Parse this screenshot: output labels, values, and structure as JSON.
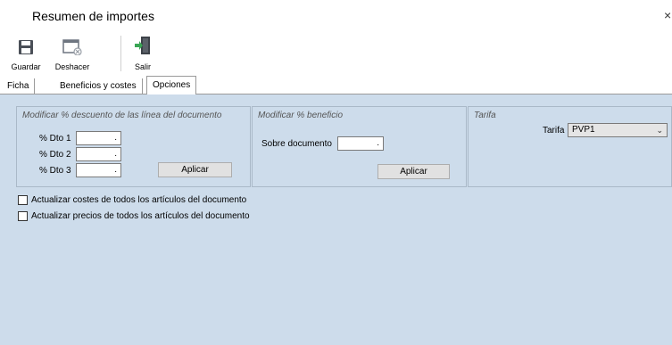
{
  "window": {
    "title": "Resumen de importes",
    "close_glyph": "×"
  },
  "toolbar": {
    "items": [
      {
        "label": "Guardar",
        "icon": "save-icon"
      },
      {
        "label": "Deshacer",
        "icon": "undo-icon"
      },
      {
        "label": "Salir",
        "icon": "exit-icon"
      }
    ]
  },
  "tabs": [
    {
      "label": "Ficha",
      "active": false
    },
    {
      "label": "Beneficios y costes",
      "active": false
    },
    {
      "label": "Opciones",
      "active": true
    }
  ],
  "discount_group": {
    "title": "Modificar % descuento de las línea del documento",
    "fields": [
      {
        "label": "% Dto 1",
        "value": "."
      },
      {
        "label": "% Dto 2",
        "value": "."
      },
      {
        "label": "% Dto 3",
        "value": "."
      }
    ],
    "apply_label": "Aplicar"
  },
  "profit_group": {
    "title": "Modificar % beneficio",
    "field_label": "Sobre documento",
    "field_value": ".",
    "apply_label": "Aplicar"
  },
  "tariff_group": {
    "title": "Tarifa",
    "field_label": "Tarifa",
    "selected": "PVP1"
  },
  "checkboxes": [
    {
      "label": "Actualizar costes de todos los artículos del documento",
      "checked": false
    },
    {
      "label": "Actualizar precios de todos los artículos del documento",
      "checked": false
    }
  ],
  "colors": {
    "panel": "#cddceb",
    "accent": "#2e8b57"
  }
}
